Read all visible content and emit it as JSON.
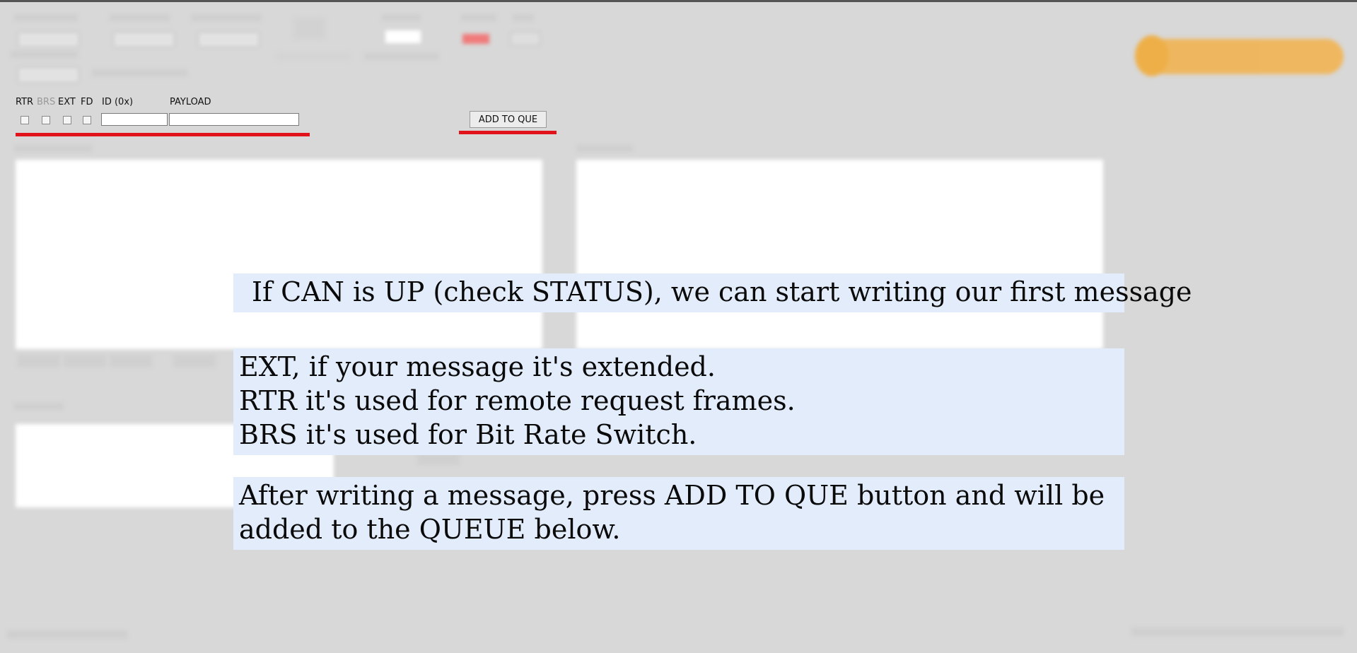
{
  "message_entry": {
    "rtr_label": "RTR",
    "brs_label": "BRS",
    "ext_label": "EXT",
    "fd_label": "FD",
    "id_label": "ID (0x)",
    "payload_label": "PAYLOAD",
    "id_value": "",
    "payload_value": "",
    "add_to_que_label": "ADD TO QUE"
  },
  "callouts": {
    "status_tip": "If CAN is UP (check STATUS), we can start writing our first message",
    "flags_tip": [
      "EXT, if your message it's extended.",
      "RTR it's used for remote request frames.",
      "BRS it's used for Bit Rate Switch."
    ],
    "queue_tip": [
      "After writing a message, press ADD TO QUE button and will be",
      "added to the QUEUE below."
    ]
  },
  "colors": {
    "highlight_underline": "#e0141a",
    "callout_background": "#e2ecfb",
    "logo_orange": "#f3b24a"
  }
}
